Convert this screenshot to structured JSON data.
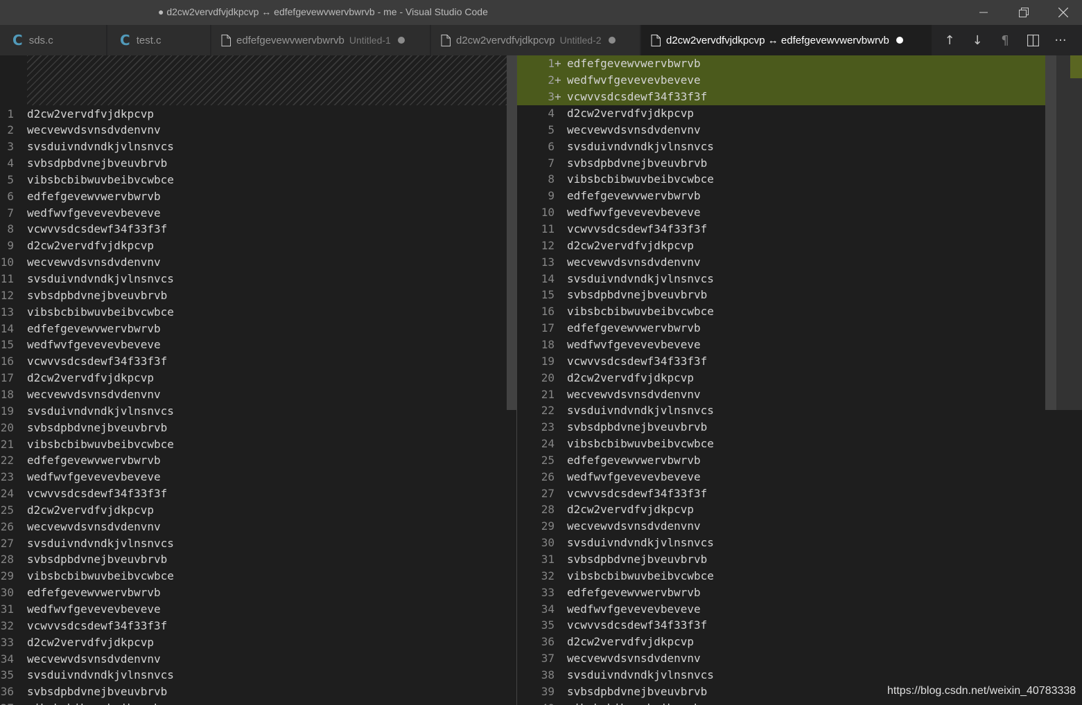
{
  "window": {
    "title": "● d2cw2vervdfvjdkpcvp ↔ edfefgevewvwervbwrvb - me - Visual Studio Code"
  },
  "tabs": [
    {
      "label": "sds.c",
      "description": "",
      "icon": "c-file-icon",
      "dirty": false,
      "active": false
    },
    {
      "label": "test.c",
      "description": "",
      "icon": "c-file-icon",
      "dirty": false,
      "active": false
    },
    {
      "label": "edfefgevewvwervbwrvb",
      "description": "Untitled-1",
      "icon": "file-icon",
      "dirty": true,
      "active": false
    },
    {
      "label": "d2cw2vervdfvjdkpcvp",
      "description": "Untitled-2",
      "icon": "file-icon",
      "dirty": true,
      "active": false
    },
    {
      "label": "d2cw2vervdfvjdkpcvp ↔ edfefgevewvwervbwrvb",
      "description": "",
      "icon": "file-icon",
      "dirty": true,
      "active": true
    }
  ],
  "icons": {
    "c_file": "C",
    "prev_change": "↑",
    "next_change": "↓",
    "whitespace": "¶",
    "split": "split-editor-icon",
    "more": "···"
  },
  "diff": {
    "inserted_lines": [
      "edfefgevewvwervbwrvb",
      "wedfwvfgevevevbeveve",
      "vcwvvsdcsdewf34f33f3f"
    ],
    "left_lines": [
      "d2cw2vervdfvjdkpcvp",
      "wecvewvdsvnsdvdenvnv",
      "svsduivndvndkjvlnsnvcs",
      "svbsdpbdvnejbveuvbrvb",
      "vibsbcbibwuvbeibvcwbce",
      "edfefgevewvwervbwrvb",
      "wedfwvfgevevevbeveve",
      "vcwvvsdcsdewf34f33f3f",
      "d2cw2vervdfvjdkpcvp",
      "wecvewvdsvnsdvdenvnv",
      "svsduivndvndkjvlnsnvcs",
      "svbsdpbdvnejbveuvbrvb",
      "vibsbcbibwuvbeibvcwbce",
      "edfefgevewvwervbwrvb",
      "wedfwvfgevevevbeveve",
      "vcwvvsdcsdewf34f33f3f",
      "d2cw2vervdfvjdkpcvp",
      "wecvewvdsvnsdvdenvnv",
      "svsduivndvndkjvlnsnvcs",
      "svbsdpbdvnejbveuvbrvb",
      "vibsbcbibwuvbeibvcwbce",
      "edfefgevewvwervbwrvb",
      "wedfwvfgevevevbeveve",
      "vcwvvsdcsdewf34f33f3f",
      "d2cw2vervdfvjdkpcvp",
      "wecvewvdsvnsdvdenvnv",
      "svsduivndvndkjvlnsnvcs",
      "svbsdpbdvnejbveuvbrvb",
      "vibsbcbibwuvbeibvcwbce",
      "edfefgevewvwervbwrvb",
      "wedfwvfgevevevbeveve",
      "vcwvvsdcsdewf34f33f3f",
      "d2cw2vervdfvjdkpcvp",
      "wecvewvdsvnsdvdenvnv",
      "svsduivndvndkjvlnsnvcs",
      "svbsdpbdvnejbveuvbrvb",
      "vibsbcbibwuvbeibvcwbce"
    ],
    "insert_marker": "+"
  },
  "colors": {
    "inserted_bg": "#4b5a1c",
    "accent_c": "#519aba"
  },
  "watermark": "https://blog.csdn.net/weixin_40783338"
}
